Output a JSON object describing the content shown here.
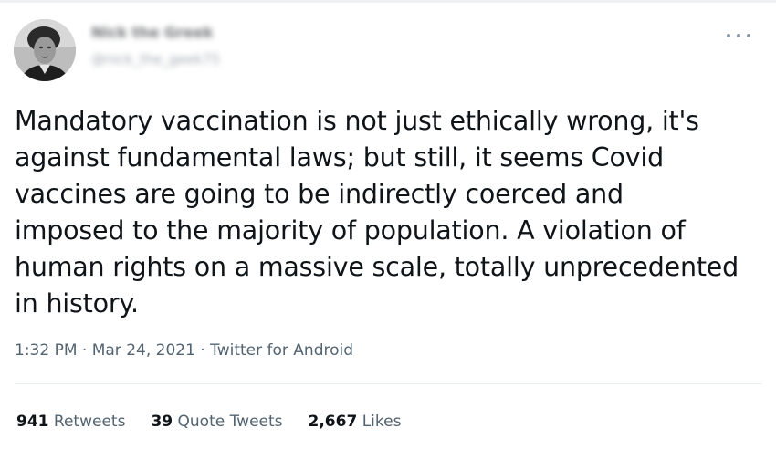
{
  "tweet": {
    "author": {
      "display_name": "Nick the Greek",
      "handle": "@nick_the_geek75"
    },
    "text_lines": [
      "Mandatory vaccination is not just ethically wrong, it's",
      "against fundamental laws; but still, it seems Covid",
      "vaccines are going to be indirectly coerced and",
      "imposed to the majority of population. A violation of",
      "human rights on a massive scale, totally unprecedented",
      "in history."
    ],
    "meta": {
      "time": "1:32 PM",
      "separator": " · ",
      "date": "Mar 24, 2021",
      "source": "Twitter for Android"
    },
    "stats": {
      "retweets_count": "941",
      "retweets_label": "Retweets",
      "quotes_count": "39",
      "quotes_label": "Quote Tweets",
      "likes_count": "2,667",
      "likes_label": "Likes"
    },
    "icons": {
      "more": "more-horizontal-icon"
    }
  }
}
